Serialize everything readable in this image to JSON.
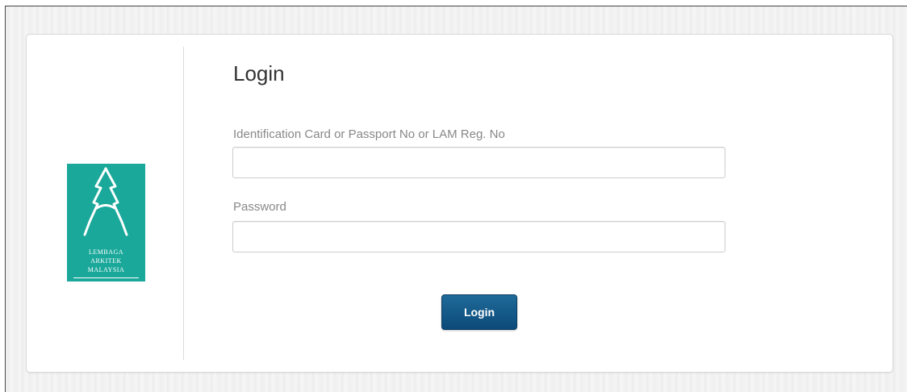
{
  "logo": {
    "lines": [
      "LEMBAGA",
      "ARKITEK",
      "MALAYSIA"
    ],
    "color": "#1aa89a"
  },
  "form": {
    "title": "Login",
    "id_label": "Identification Card or Passport No or LAM Reg. No",
    "id_value": "",
    "password_label": "Password",
    "password_value": "",
    "submit_label": "Login"
  },
  "colors": {
    "button": "#0c4a78",
    "label": "#888888"
  }
}
